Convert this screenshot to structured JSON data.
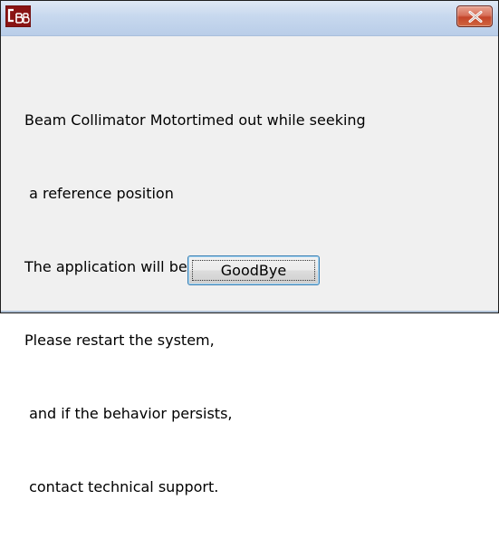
{
  "dialog": {
    "title": "",
    "message_lines": [
      "Beam Collimator Motortimed out while seeking",
      " a reference position",
      "The application will be terminated.",
      "Please restart the system,",
      " and if the behavior persists,",
      " contact technical support."
    ],
    "button_label": "GoodBye"
  },
  "icons": {
    "app": "application-icon",
    "close": "close-icon"
  },
  "colors": {
    "close_button": "#c4452a",
    "titlebar": "#c7d8ee",
    "dialog_background": "#f0f0f0",
    "button_border": "#3c7fb1"
  }
}
